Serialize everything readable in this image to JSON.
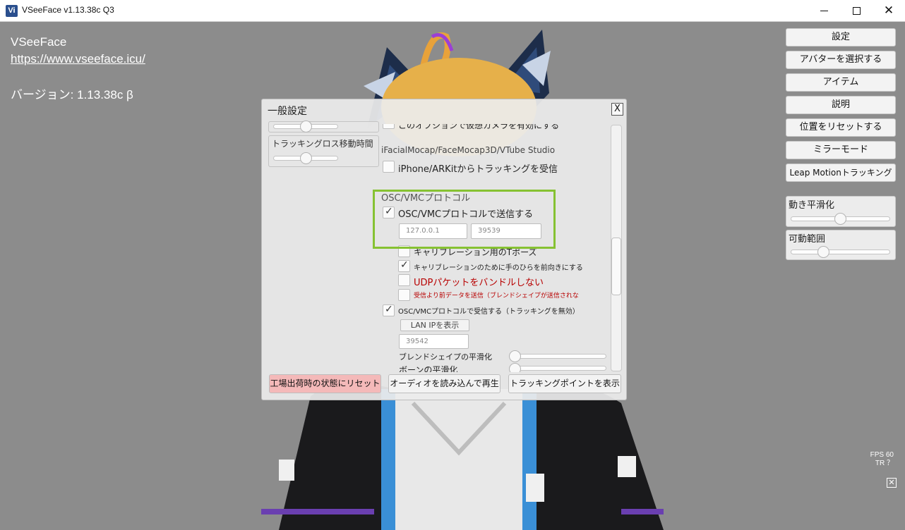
{
  "window": {
    "title": "VSeeFace v1.13.38c Q3",
    "icon_letter": "Vi"
  },
  "info": {
    "app_name": "VSeeFace",
    "url": "https://www.vseeface.icu/",
    "version": "バージョン: 1.13.38c β"
  },
  "sidebar": {
    "buttons": [
      "設定",
      "アバターを選択する",
      "アイテム",
      "説明",
      "位置をリセットする",
      "ミラーモード",
      "Leap Motionトラッキング"
    ],
    "smoothing_label": "動き平滑化",
    "smoothing_value": 0.5,
    "range_label": "可動範囲",
    "range_value": 0.3
  },
  "status": {
    "fps": "FPS 60",
    "tr": "TR ？"
  },
  "dialog": {
    "title": "一般設定",
    "close_label": "X",
    "left_panel": {
      "tracking_move_label": "トラッキングロス移動時間",
      "slider1_value": 0.4,
      "slider2_value": 0.4
    },
    "clipped_top_text": "このオプションで仮想カメラを有効にする",
    "ifacial_header": "iFacialMocap/FaceMocap3D/VTube Studio",
    "iphone_label": "iPhone/ARKitからトラッキングを受信",
    "iphone_checked": false,
    "osc_header": "OSC/VMCプロトコル",
    "osc_send_label": "OSC/VMCプロトコルで送信する",
    "osc_send_checked": true,
    "osc_ip_value": "127.0.0.1",
    "osc_port_value": "39539",
    "calibration_tpose_label": "キャリブレーション用のTポーズ",
    "calibration_palm_label": "キャリブレーションのために手のひらを前向きにする",
    "calibration_palm_checked": true,
    "udp_bundle_label": "UDPパケットをバンドルしない",
    "send_before_receive_label": "受信より前データを送信（ブレンドシェイプが送信されな",
    "osc_receive_label": "OSC/VMCプロトコルで受信する（トラッキングを無効）",
    "osc_receive_checked": true,
    "lan_ip_button": "LAN IPを表示",
    "receive_port_value": "39542",
    "blendshape_smoothing_label": "ブレンドシェイプの平滑化",
    "bone_smoothing_label": "ボーンの平滑化",
    "footer": {
      "reset_label": "工場出荷時の状態にリセット",
      "audio_label": "オーディオを読み込んで再生",
      "tracking_points_label": "トラッキングポイントを表示"
    },
    "colors": {
      "warning_red": "#b80000",
      "reset_pink": "#f4b9b9",
      "highlight_green": "#86c232"
    }
  }
}
